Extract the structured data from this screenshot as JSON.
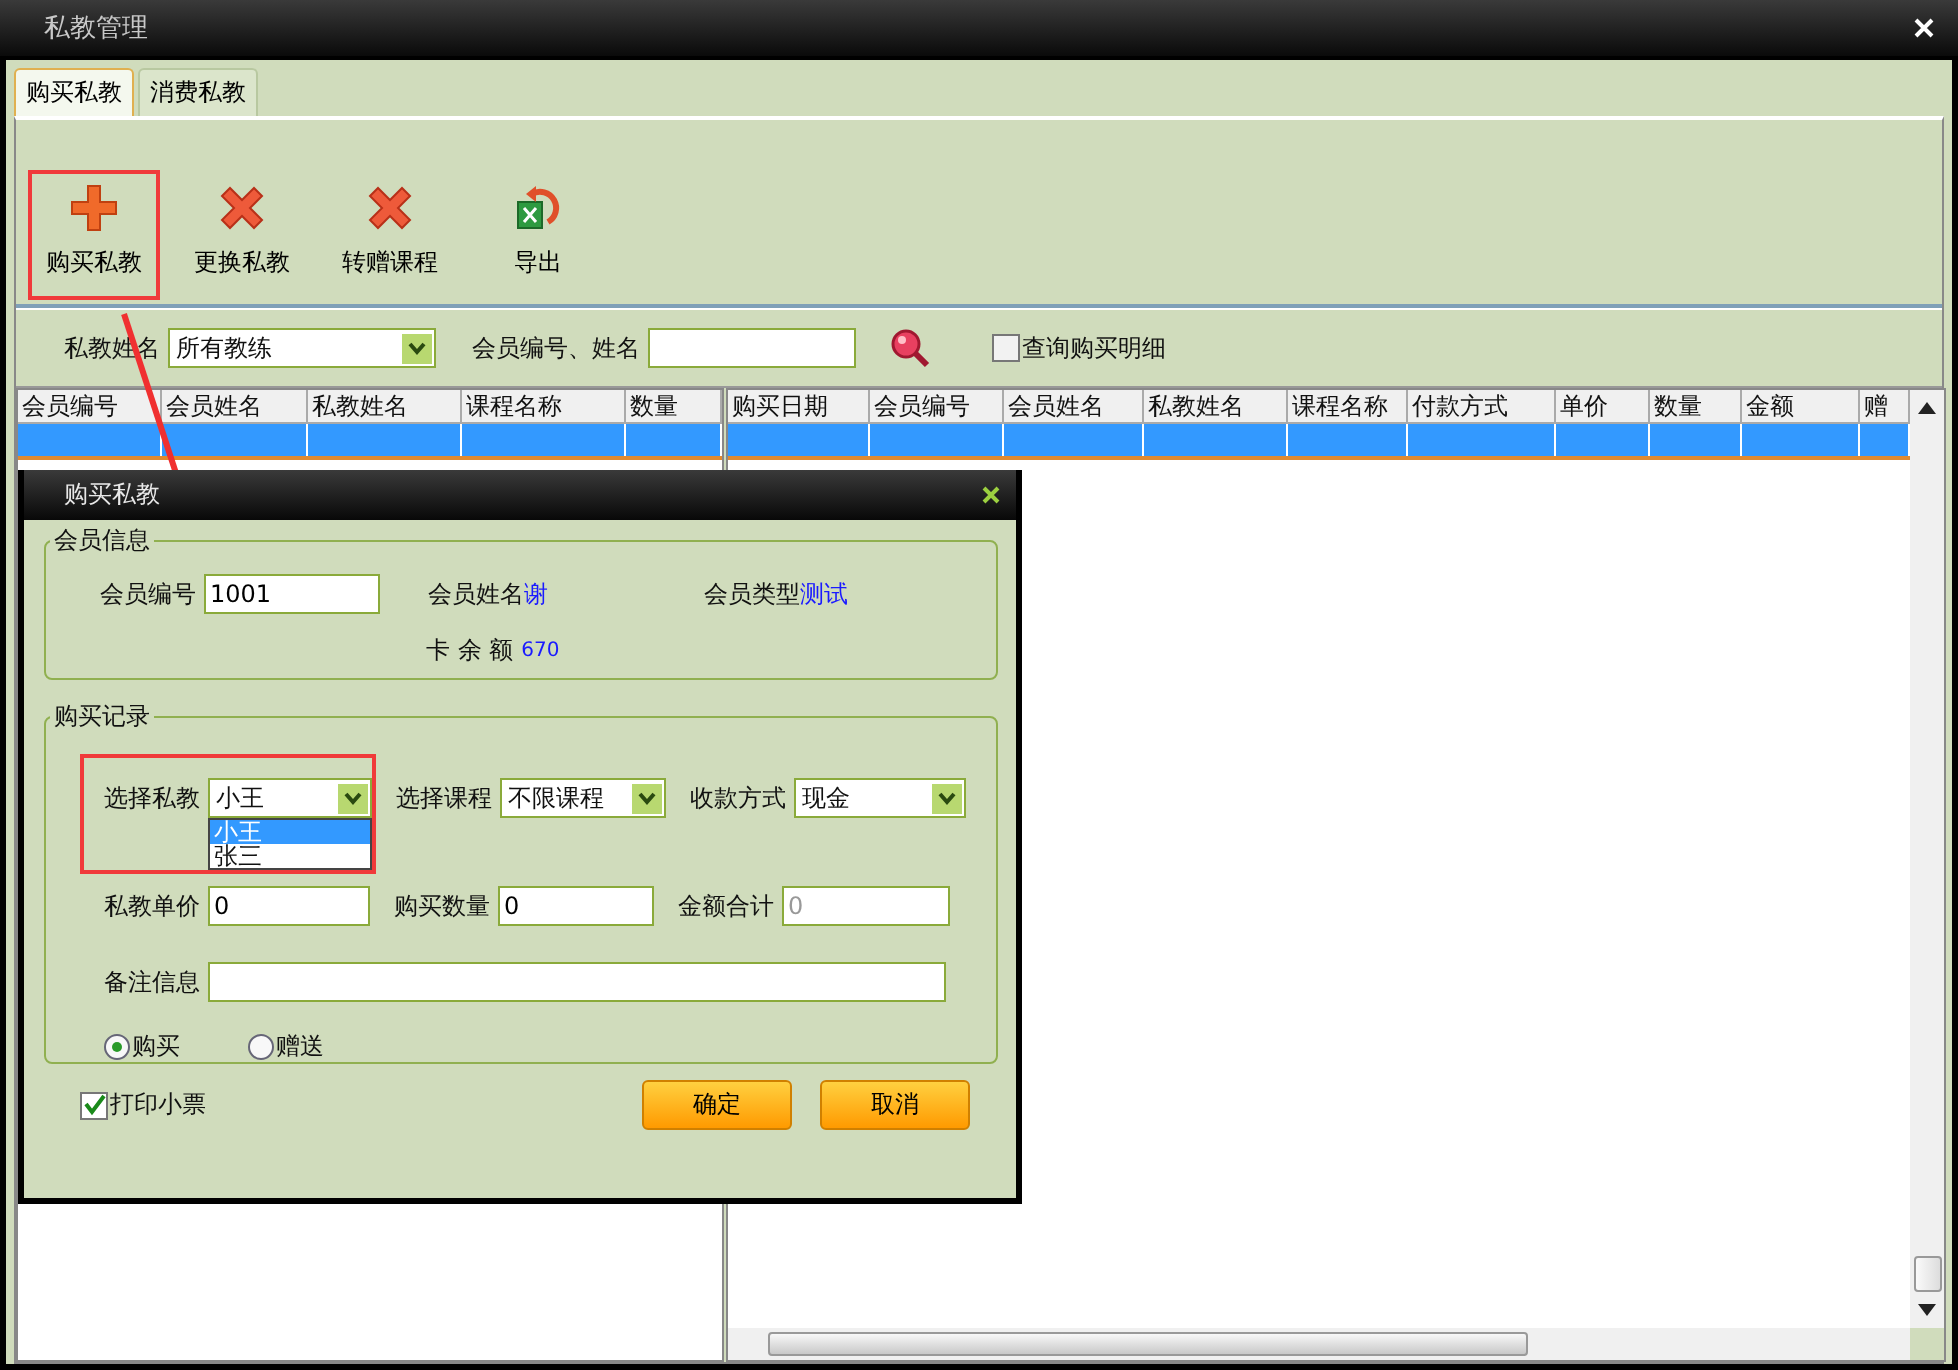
{
  "window": {
    "title": "私教管理"
  },
  "tabs": [
    {
      "label": "购买私教",
      "selected": true
    },
    {
      "label": "消费私教",
      "selected": false
    }
  ],
  "toolbar": [
    {
      "label": "购买私教",
      "kind": "plus",
      "highlighted": true
    },
    {
      "label": "更换私教",
      "kind": "cross",
      "highlighted": false
    },
    {
      "label": "转赠课程",
      "kind": "cross",
      "highlighted": false
    },
    {
      "label": "导出",
      "kind": "export",
      "highlighted": false
    }
  ],
  "filter": {
    "trainer_label": "私教姓名",
    "trainer_value": "所有教练",
    "member_label": "会员编号、姓名",
    "detail_checkbox": {
      "label": "查询购买明细",
      "checked": false
    }
  },
  "left_table": {
    "columns": [
      "会员编号",
      "会员姓名",
      "私教姓名",
      "课程名称",
      "数量"
    ],
    "rows": [
      {
        "selected": true
      }
    ]
  },
  "right_table": {
    "columns": [
      "购买日期",
      "会员编号",
      "会员姓名",
      "私教姓名",
      "课程名称",
      "付款方式",
      "单价",
      "数量",
      "金额",
      "赠"
    ],
    "rows": [
      {
        "selected": true
      }
    ]
  },
  "dialog": {
    "title": "购买私教",
    "member_group": {
      "title": "会员信息",
      "member_no_label": "会员编号",
      "member_no": "1001",
      "name_label": "会员姓名",
      "name": "谢",
      "type_label": "会员类型",
      "type": "测试",
      "balance_label": "卡 余 额",
      "balance": "670"
    },
    "purchase_group": {
      "title": "购买记录",
      "trainer": {
        "label": "选择私教",
        "value": "小王",
        "highlighted": true,
        "options": [
          {
            "label": "小王",
            "selected": true
          },
          {
            "label": "张三",
            "selected": false
          }
        ]
      },
      "course": {
        "label": "选择课程",
        "value": "不限课程"
      },
      "payment": {
        "label": "收款方式",
        "value": "现金"
      },
      "price": {
        "label": "私教单价",
        "value": "0"
      },
      "quantity": {
        "label": "购买数量",
        "value": "0"
      },
      "total": {
        "label": "金额合计",
        "value": "0",
        "disabled": true
      },
      "note": {
        "label": "备注信息"
      },
      "mode": [
        {
          "label": "购买",
          "selected": true
        },
        {
          "label": "赠送",
          "selected": false
        }
      ]
    },
    "print_ticket": {
      "label": "打印小票",
      "checked": true
    },
    "buttons": [
      "确定",
      "取消"
    ]
  }
}
